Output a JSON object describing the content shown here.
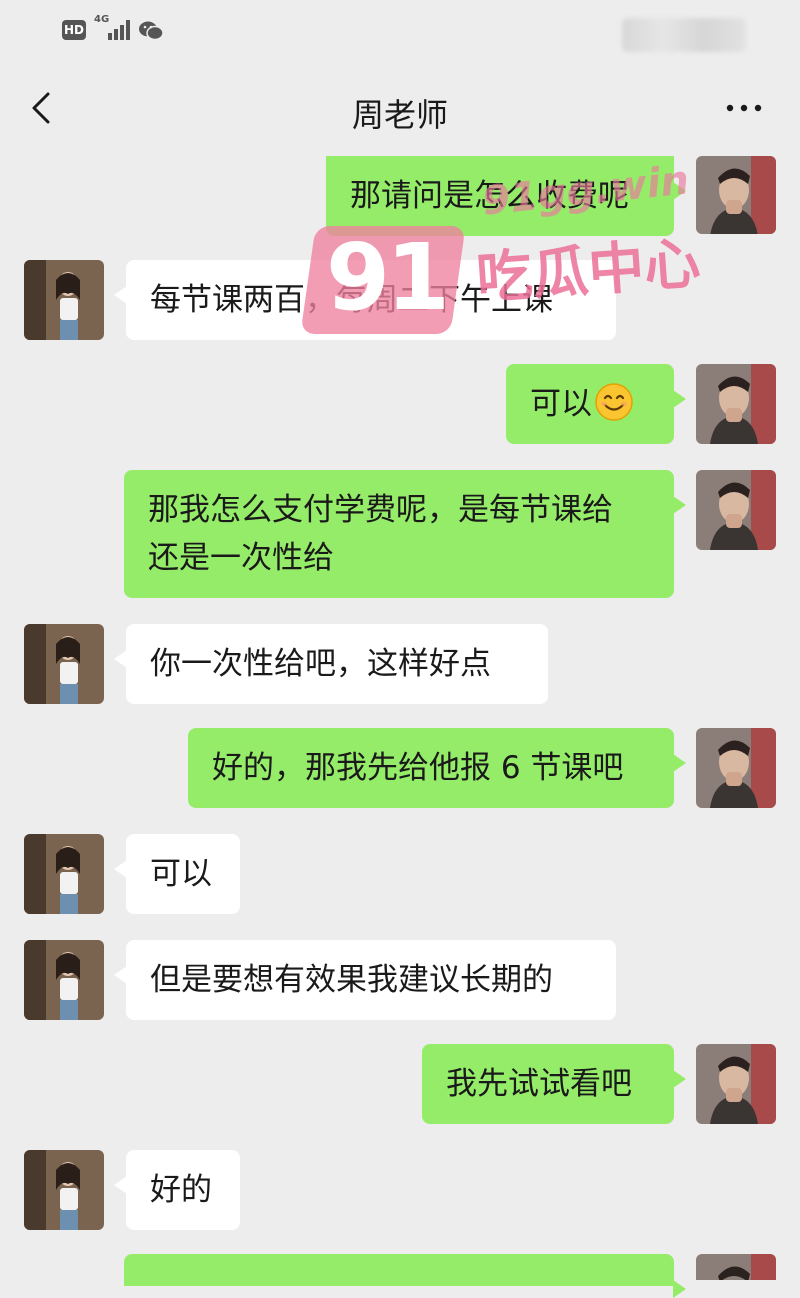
{
  "status_bar": {
    "hd_label": "HD",
    "network_label": "4G"
  },
  "header": {
    "title": "周老师"
  },
  "messages": [
    {
      "side": "me",
      "lines": [
        "那请问是怎么收费呢"
      ]
    },
    {
      "side": "them",
      "lines": [
        "每节课两百，每周二下午上课"
      ]
    },
    {
      "side": "me",
      "lines": [
        "可以"
      ],
      "emoji": "smiling-face-emoji"
    },
    {
      "side": "me",
      "lines": [
        "那我怎么支付学费呢，是每节课给",
        "还是一次性给"
      ]
    },
    {
      "side": "them",
      "lines": [
        "你一次性给吧，这样好点"
      ]
    },
    {
      "side": "me",
      "lines": [
        "好的，那我先给他报 6 节课吧"
      ]
    },
    {
      "side": "them",
      "lines": [
        "可以"
      ]
    },
    {
      "side": "them",
      "lines": [
        "但是要想有效果我建议长期的"
      ]
    },
    {
      "side": "me",
      "lines": [
        "我先试试看吧"
      ]
    },
    {
      "side": "them",
      "lines": [
        "好的"
      ]
    }
  ],
  "watermark": {
    "number": "91",
    "site": "91gg.win",
    "brand": "吃瓜中心"
  },
  "colors": {
    "background": "#ededed",
    "my_bubble": "#95ec69",
    "their_bubble": "#ffffff",
    "watermark": "#eb7aa0"
  }
}
